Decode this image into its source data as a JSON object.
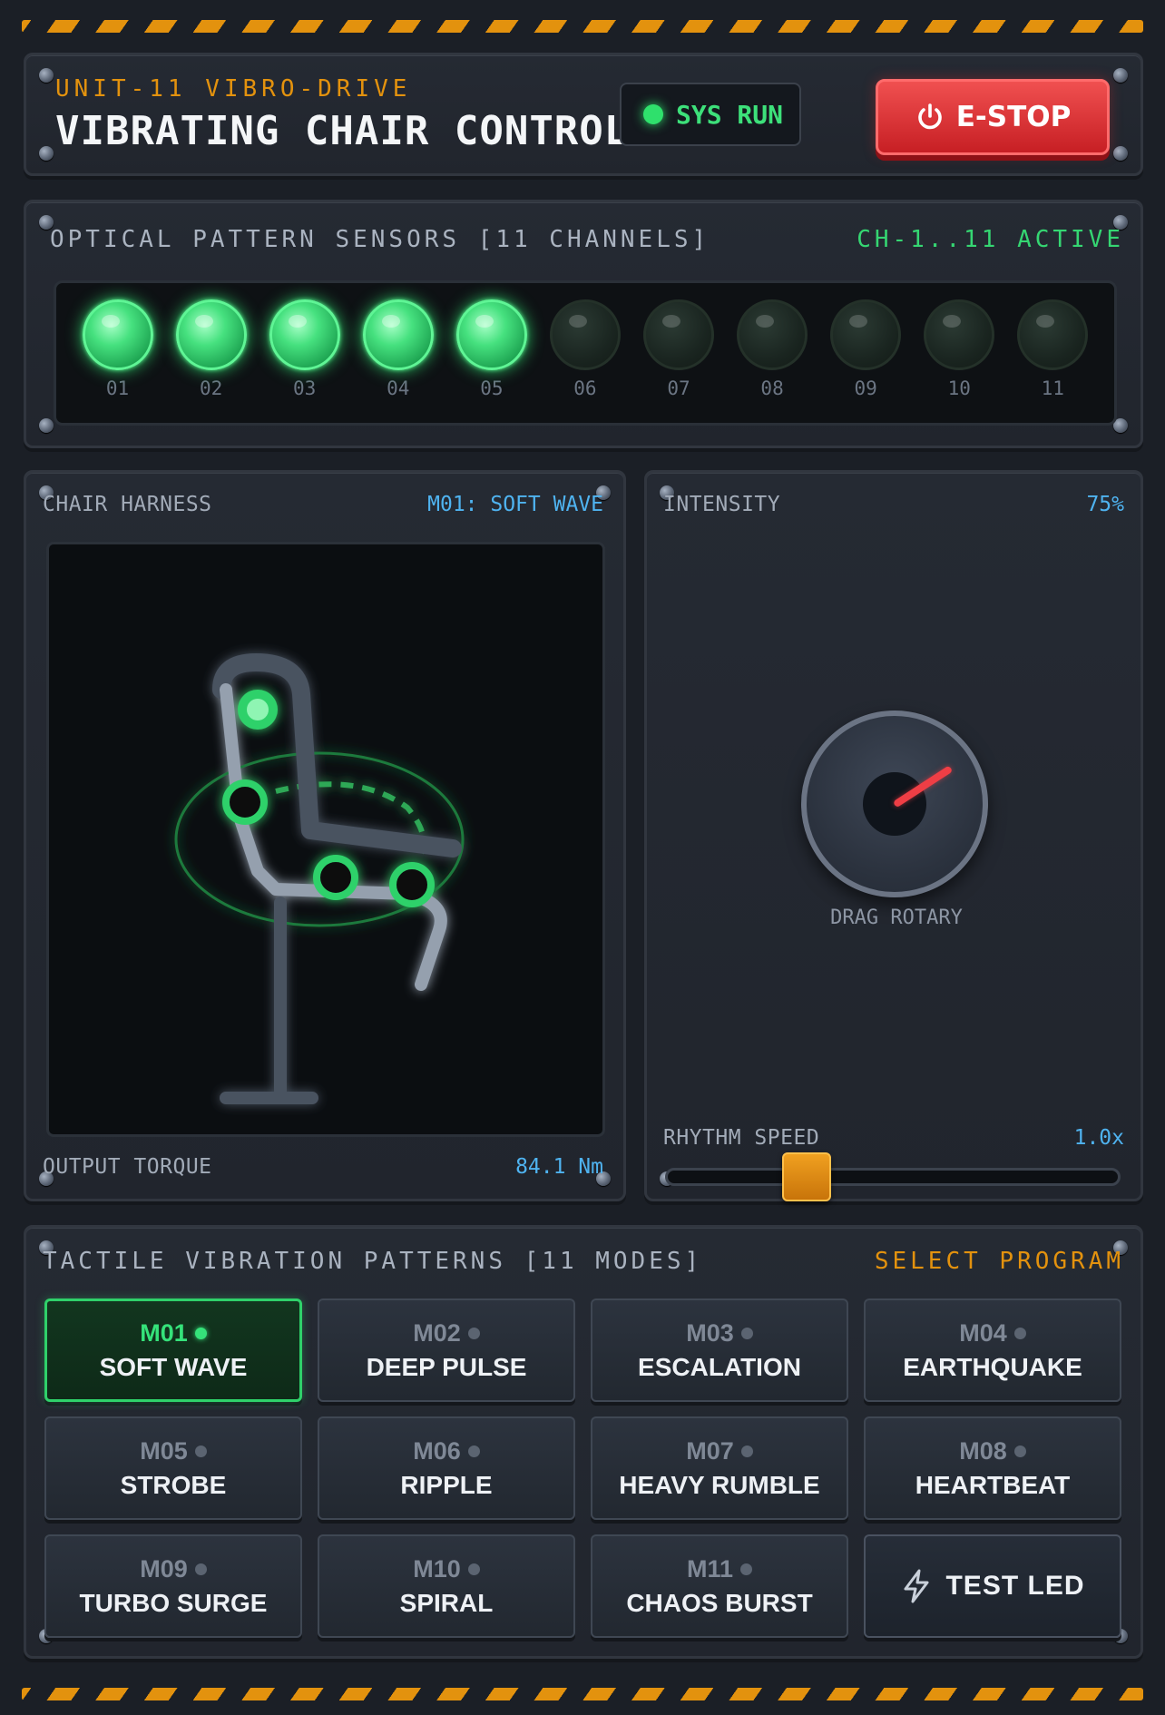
{
  "header": {
    "subtitle": "UNIT-11 VIBRO-DRIVE",
    "title": "VIBRATING CHAIR CONTROL",
    "status": "SYS RUN",
    "estop_label": "E-STOP"
  },
  "sensors": {
    "label": "OPTICAL PATTERN SENSORS [11 CHANNELS]",
    "status": "CH-1..11 ACTIVE",
    "channels": [
      {
        "num": "01",
        "on": true
      },
      {
        "num": "02",
        "on": true
      },
      {
        "num": "03",
        "on": true
      },
      {
        "num": "04",
        "on": true
      },
      {
        "num": "05",
        "on": true
      },
      {
        "num": "06",
        "on": false
      },
      {
        "num": "07",
        "on": false
      },
      {
        "num": "08",
        "on": false
      },
      {
        "num": "09",
        "on": false
      },
      {
        "num": "10",
        "on": false
      },
      {
        "num": "11",
        "on": false
      }
    ]
  },
  "harness": {
    "label": "CHAIR HARNESS",
    "mode": "M01: SOFT WAVE",
    "torque_label": "OUTPUT TORQUE",
    "torque_value": "84.1 Nm"
  },
  "intensity": {
    "label": "INTENSITY",
    "value": "75%",
    "dial_caption": "DRAG ROTARY",
    "rhythm_label": "RHYTHM SPEED",
    "rhythm_value": "1.0x",
    "rhythm_fraction": 0.3
  },
  "patterns": {
    "label": "TACTILE VIBRATION PATTERNS [11 MODES]",
    "action": "SELECT PROGRAM",
    "modes": [
      {
        "code": "M01",
        "name": "SOFT WAVE",
        "active": true
      },
      {
        "code": "M02",
        "name": "DEEP PULSE",
        "active": false
      },
      {
        "code": "M03",
        "name": "ESCALATION",
        "active": false
      },
      {
        "code": "M04",
        "name": "EARTHQUAKE",
        "active": false
      },
      {
        "code": "M05",
        "name": "STROBE",
        "active": false
      },
      {
        "code": "M06",
        "name": "RIPPLE",
        "active": false
      },
      {
        "code": "M07",
        "name": "HEAVY RUMBLE",
        "active": false
      },
      {
        "code": "M08",
        "name": "HEARTBEAT",
        "active": false
      },
      {
        "code": "M09",
        "name": "TURBO SURGE",
        "active": false
      },
      {
        "code": "M10",
        "name": "SPIRAL",
        "active": false
      },
      {
        "code": "M11",
        "name": "CHAOS BURST",
        "active": false
      }
    ],
    "test_label": "TEST LED"
  },
  "colors": {
    "accent_green": "#2fd16a",
    "accent_orange": "#e3920e",
    "estop_red": "#d8282e",
    "value_blue": "#4fb3f0"
  }
}
